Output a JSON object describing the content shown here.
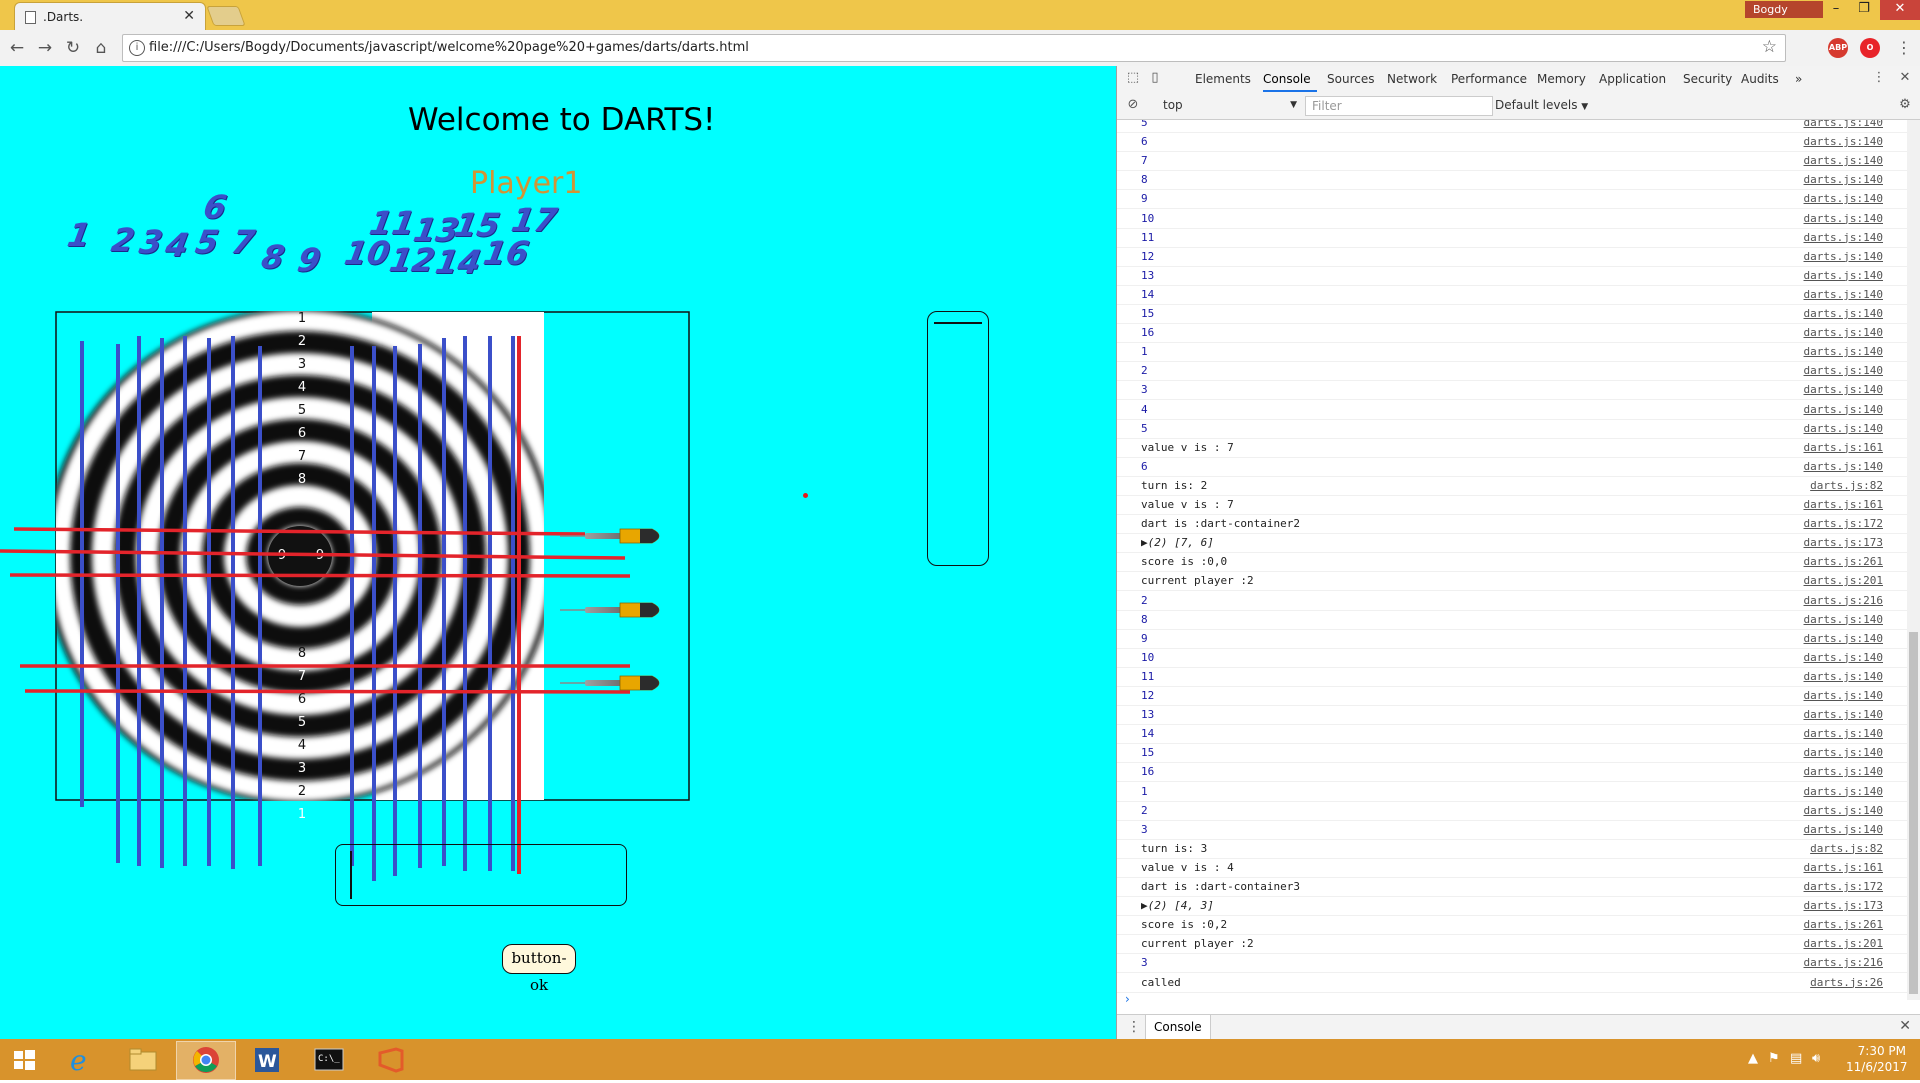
{
  "browser": {
    "tab_title": ".Darts.",
    "url": "file:///C:/Users/Bogdy/Documents/javascript/welcome%20page%20+games/darts/darts.html",
    "profile": "Bogdy",
    "abp": "ABP"
  },
  "page": {
    "title": "Welcome to DARTS!",
    "player": "Player1",
    "ok_button": "button-ok",
    "numbers": [
      "1",
      "2",
      "3",
      "4",
      "5",
      "6",
      "7",
      "8",
      "9",
      "10",
      "11",
      "12",
      "13",
      "14",
      "15",
      "16",
      "17"
    ],
    "ring_labels_top": [
      "1",
      "2",
      "3",
      "4",
      "5",
      "6",
      "7",
      "8"
    ],
    "ring_labels_bottom": [
      "8",
      "7",
      "6",
      "5",
      "4",
      "3",
      "2",
      "1"
    ],
    "bull_labels": [
      "9",
      "9",
      "9"
    ],
    "row_labels": [
      "1",
      "2",
      "3",
      "4",
      "5",
      "6",
      "7",
      "8",
      "8",
      "7",
      "6",
      "5",
      "4",
      "3",
      "2",
      "1"
    ]
  },
  "devtools": {
    "tabs": [
      "Elements",
      "Console",
      "Sources",
      "Network",
      "Performance",
      "Memory",
      "Application",
      "Security",
      "Audits"
    ],
    "context": "top",
    "filter_placeholder": "Filter",
    "levels": "Default levels",
    "drawer_tab": "Console",
    "logs": [
      {
        "msg": "5",
        "src": "darts.js:140",
        "type": "num"
      },
      {
        "msg": "6",
        "src": "darts.js:140",
        "type": "num"
      },
      {
        "msg": "7",
        "src": "darts.js:140",
        "type": "num"
      },
      {
        "msg": "8",
        "src": "darts.js:140",
        "type": "num"
      },
      {
        "msg": "9",
        "src": "darts.js:140",
        "type": "num"
      },
      {
        "msg": "10",
        "src": "darts.js:140",
        "type": "num"
      },
      {
        "msg": "11",
        "src": "darts.js:140",
        "type": "num"
      },
      {
        "msg": "12",
        "src": "darts.js:140",
        "type": "num"
      },
      {
        "msg": "13",
        "src": "darts.js:140",
        "type": "num"
      },
      {
        "msg": "14",
        "src": "darts.js:140",
        "type": "num"
      },
      {
        "msg": "15",
        "src": "darts.js:140",
        "type": "num"
      },
      {
        "msg": "16",
        "src": "darts.js:140",
        "type": "num"
      },
      {
        "msg": "1",
        "src": "darts.js:140",
        "type": "num"
      },
      {
        "msg": "2",
        "src": "darts.js:140",
        "type": "num"
      },
      {
        "msg": "3",
        "src": "darts.js:140",
        "type": "num"
      },
      {
        "msg": "4",
        "src": "darts.js:140",
        "type": "num"
      },
      {
        "msg": "5",
        "src": "darts.js:140",
        "type": "num"
      },
      {
        "msg": "value v is : 7",
        "src": "darts.js:161",
        "type": "text"
      },
      {
        "msg": "6",
        "src": "darts.js:140",
        "type": "num"
      },
      {
        "msg": "turn is: 2",
        "src": "darts.js:82",
        "type": "text"
      },
      {
        "msg": "value v is : 7",
        "src": "darts.js:161",
        "type": "text"
      },
      {
        "msg": "dart is :dart-container2",
        "src": "darts.js:172",
        "type": "text"
      },
      {
        "msg": "▶(2) [7, 6]",
        "src": "darts.js:173",
        "type": "arr"
      },
      {
        "msg": "score is :0,0",
        "src": "darts.js:261",
        "type": "text"
      },
      {
        "msg": "current player :2",
        "src": "darts.js:201",
        "type": "text"
      },
      {
        "msg": "2",
        "src": "darts.js:216",
        "type": "num"
      },
      {
        "msg": "8",
        "src": "darts.js:140",
        "type": "num"
      },
      {
        "msg": "9",
        "src": "darts.js:140",
        "type": "num"
      },
      {
        "msg": "10",
        "src": "darts.js:140",
        "type": "num"
      },
      {
        "msg": "11",
        "src": "darts.js:140",
        "type": "num"
      },
      {
        "msg": "12",
        "src": "darts.js:140",
        "type": "num"
      },
      {
        "msg": "13",
        "src": "darts.js:140",
        "type": "num"
      },
      {
        "msg": "14",
        "src": "darts.js:140",
        "type": "num"
      },
      {
        "msg": "15",
        "src": "darts.js:140",
        "type": "num"
      },
      {
        "msg": "16",
        "src": "darts.js:140",
        "type": "num"
      },
      {
        "msg": "1",
        "src": "darts.js:140",
        "type": "num"
      },
      {
        "msg": "2",
        "src": "darts.js:140",
        "type": "num"
      },
      {
        "msg": "3",
        "src": "darts.js:140",
        "type": "num"
      },
      {
        "msg": "turn is: 3",
        "src": "darts.js:82",
        "type": "text"
      },
      {
        "msg": "value v is : 4",
        "src": "darts.js:161",
        "type": "text"
      },
      {
        "msg": "dart is :dart-container3",
        "src": "darts.js:172",
        "type": "text"
      },
      {
        "msg": "▶(2) [4, 3]",
        "src": "darts.js:173",
        "type": "arr"
      },
      {
        "msg": "score is :0,2",
        "src": "darts.js:261",
        "type": "text"
      },
      {
        "msg": "current player :2",
        "src": "darts.js:201",
        "type": "text"
      },
      {
        "msg": "3",
        "src": "darts.js:216",
        "type": "num"
      },
      {
        "msg": "called",
        "src": "darts.js:26",
        "type": "text"
      }
    ]
  },
  "taskbar": {
    "time": "7:30 PM",
    "date": "11/6/2017"
  }
}
